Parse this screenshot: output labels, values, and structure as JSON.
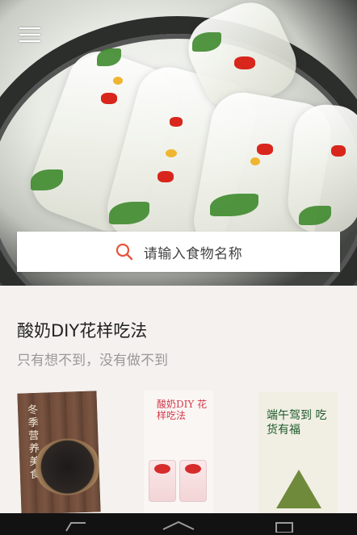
{
  "header": {
    "menu_icon": "hamburger-menu-icon",
    "hero_image": "spring-rolls-photo"
  },
  "search": {
    "placeholder": "请输入食物名称",
    "icon": "search-icon",
    "accent": "#e8533b"
  },
  "feature": {
    "title": "酸奶DIY花样吃法",
    "subtitle": "只有想不到，没有做不到"
  },
  "cards": [
    {
      "title": "冬季营养美食"
    },
    {
      "title": "酸奶DIY 花样吃法"
    },
    {
      "title": "端午驾到 吃货有福"
    }
  ],
  "system_nav": {
    "back_icon": "back-icon",
    "home_icon": "home-icon",
    "recents_icon": "recents-icon"
  }
}
